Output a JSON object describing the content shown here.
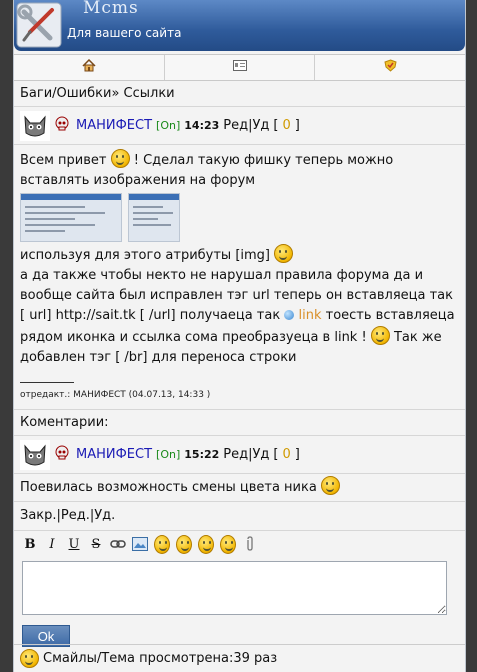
{
  "header": {
    "title": "Mcms",
    "subtitle": "Для вашего сайта"
  },
  "nav": {
    "home_icon": "home-icon",
    "profile_icon": "profile-card-icon",
    "shield_icon": "shield-icon"
  },
  "breadcrumb": "Баги/Ошибки» Ссылки",
  "post1": {
    "author": "МАНИФЕСТ",
    "status": "[On]",
    "time": "14:23",
    "actions": "Ред|Уд",
    "count_open": "[",
    "count": "0",
    "count_close": "]",
    "line1_a": "Всем привет",
    "line1_b": "! Сделал такую фишку теперь можно вставлять изображения на форум",
    "line2": "используя для этого атрибуты [img]",
    "line3": "а да также чтобы некто не нарушал правила форума да и вообще сайта был исправлен тэг url теперь он вставляеца так [ url] http://sait.tk [ /url] получаеца так",
    "link_word": "link",
    "line3_b": "тоесть вставляеца рядом иконка и ссылка сома преобразуеца в link !",
    "line3_c": "Так же добавлен тэг [ /br] для переноса строки",
    "edit_note": "отредакт.: МАНИФЕСТ (04.07.13, 14:33 )"
  },
  "comments_label": "Коментарии:",
  "post2": {
    "author": "МАНИФЕСТ",
    "status": "[On]",
    "time": "15:22",
    "actions": "Ред|Уд",
    "count_open": "[",
    "count": "0",
    "count_close": "]",
    "text": "Поевилась возможность смены цвета ника"
  },
  "thread_actions": "Закр.|Ред.|Уд.",
  "editor": {
    "ok_label": "Ok",
    "textarea_value": ""
  },
  "footer": {
    "text": "Смайлы/Тема просмотрена:39 раз"
  }
}
